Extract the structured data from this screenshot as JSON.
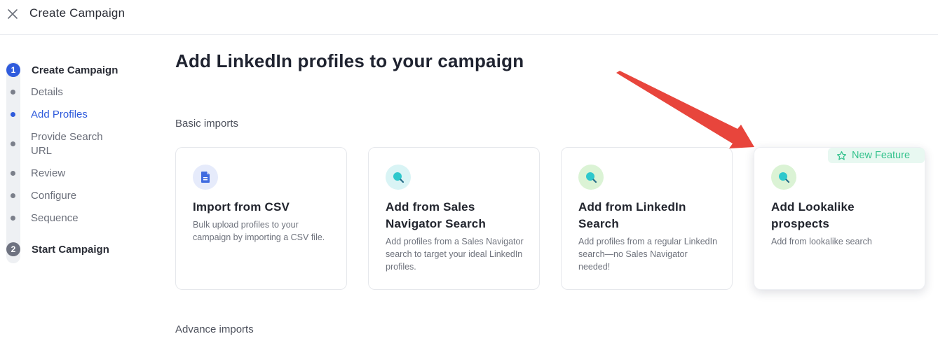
{
  "header": {
    "title": "Create Campaign"
  },
  "stepper": {
    "step1": {
      "number": "1",
      "label": "Create Campaign"
    },
    "substeps": [
      {
        "label": "Details",
        "active": false
      },
      {
        "label": "Add Profiles",
        "active": true
      },
      {
        "label": "Provide Search URL",
        "active": false
      },
      {
        "label": "Review",
        "active": false
      },
      {
        "label": "Configure",
        "active": false
      },
      {
        "label": "Sequence",
        "active": false
      }
    ],
    "step2": {
      "number": "2",
      "label": "Start Campaign"
    }
  },
  "main": {
    "title": "Add LinkedIn profiles to your campaign",
    "basic_imports_label": "Basic imports",
    "advance_imports_label": "Advance imports",
    "cards": [
      {
        "title": "Import from CSV",
        "description": "Bulk upload profiles to your campaign by importing a CSV file.",
        "icon": "document-icon"
      },
      {
        "title": "Add from Sales Navigator Search",
        "description": "Add profiles from a Sales Navigator search to target your ideal LinkedIn profiles.",
        "icon": "search-icon"
      },
      {
        "title": "Add from LinkedIn Search",
        "description": "Add profiles from a regular LinkedIn search—no Sales Navigator needed!",
        "icon": "search-icon"
      },
      {
        "title": "Add Lookalike prospects",
        "description": "Add from lookalike search",
        "icon": "search-icon"
      }
    ],
    "badge": {
      "text": "New Feature",
      "icon": "star-icon"
    }
  },
  "colors": {
    "accent": "#2f5bdc",
    "badge_green": "#34c28d",
    "arrow_red": "#e8453c"
  }
}
